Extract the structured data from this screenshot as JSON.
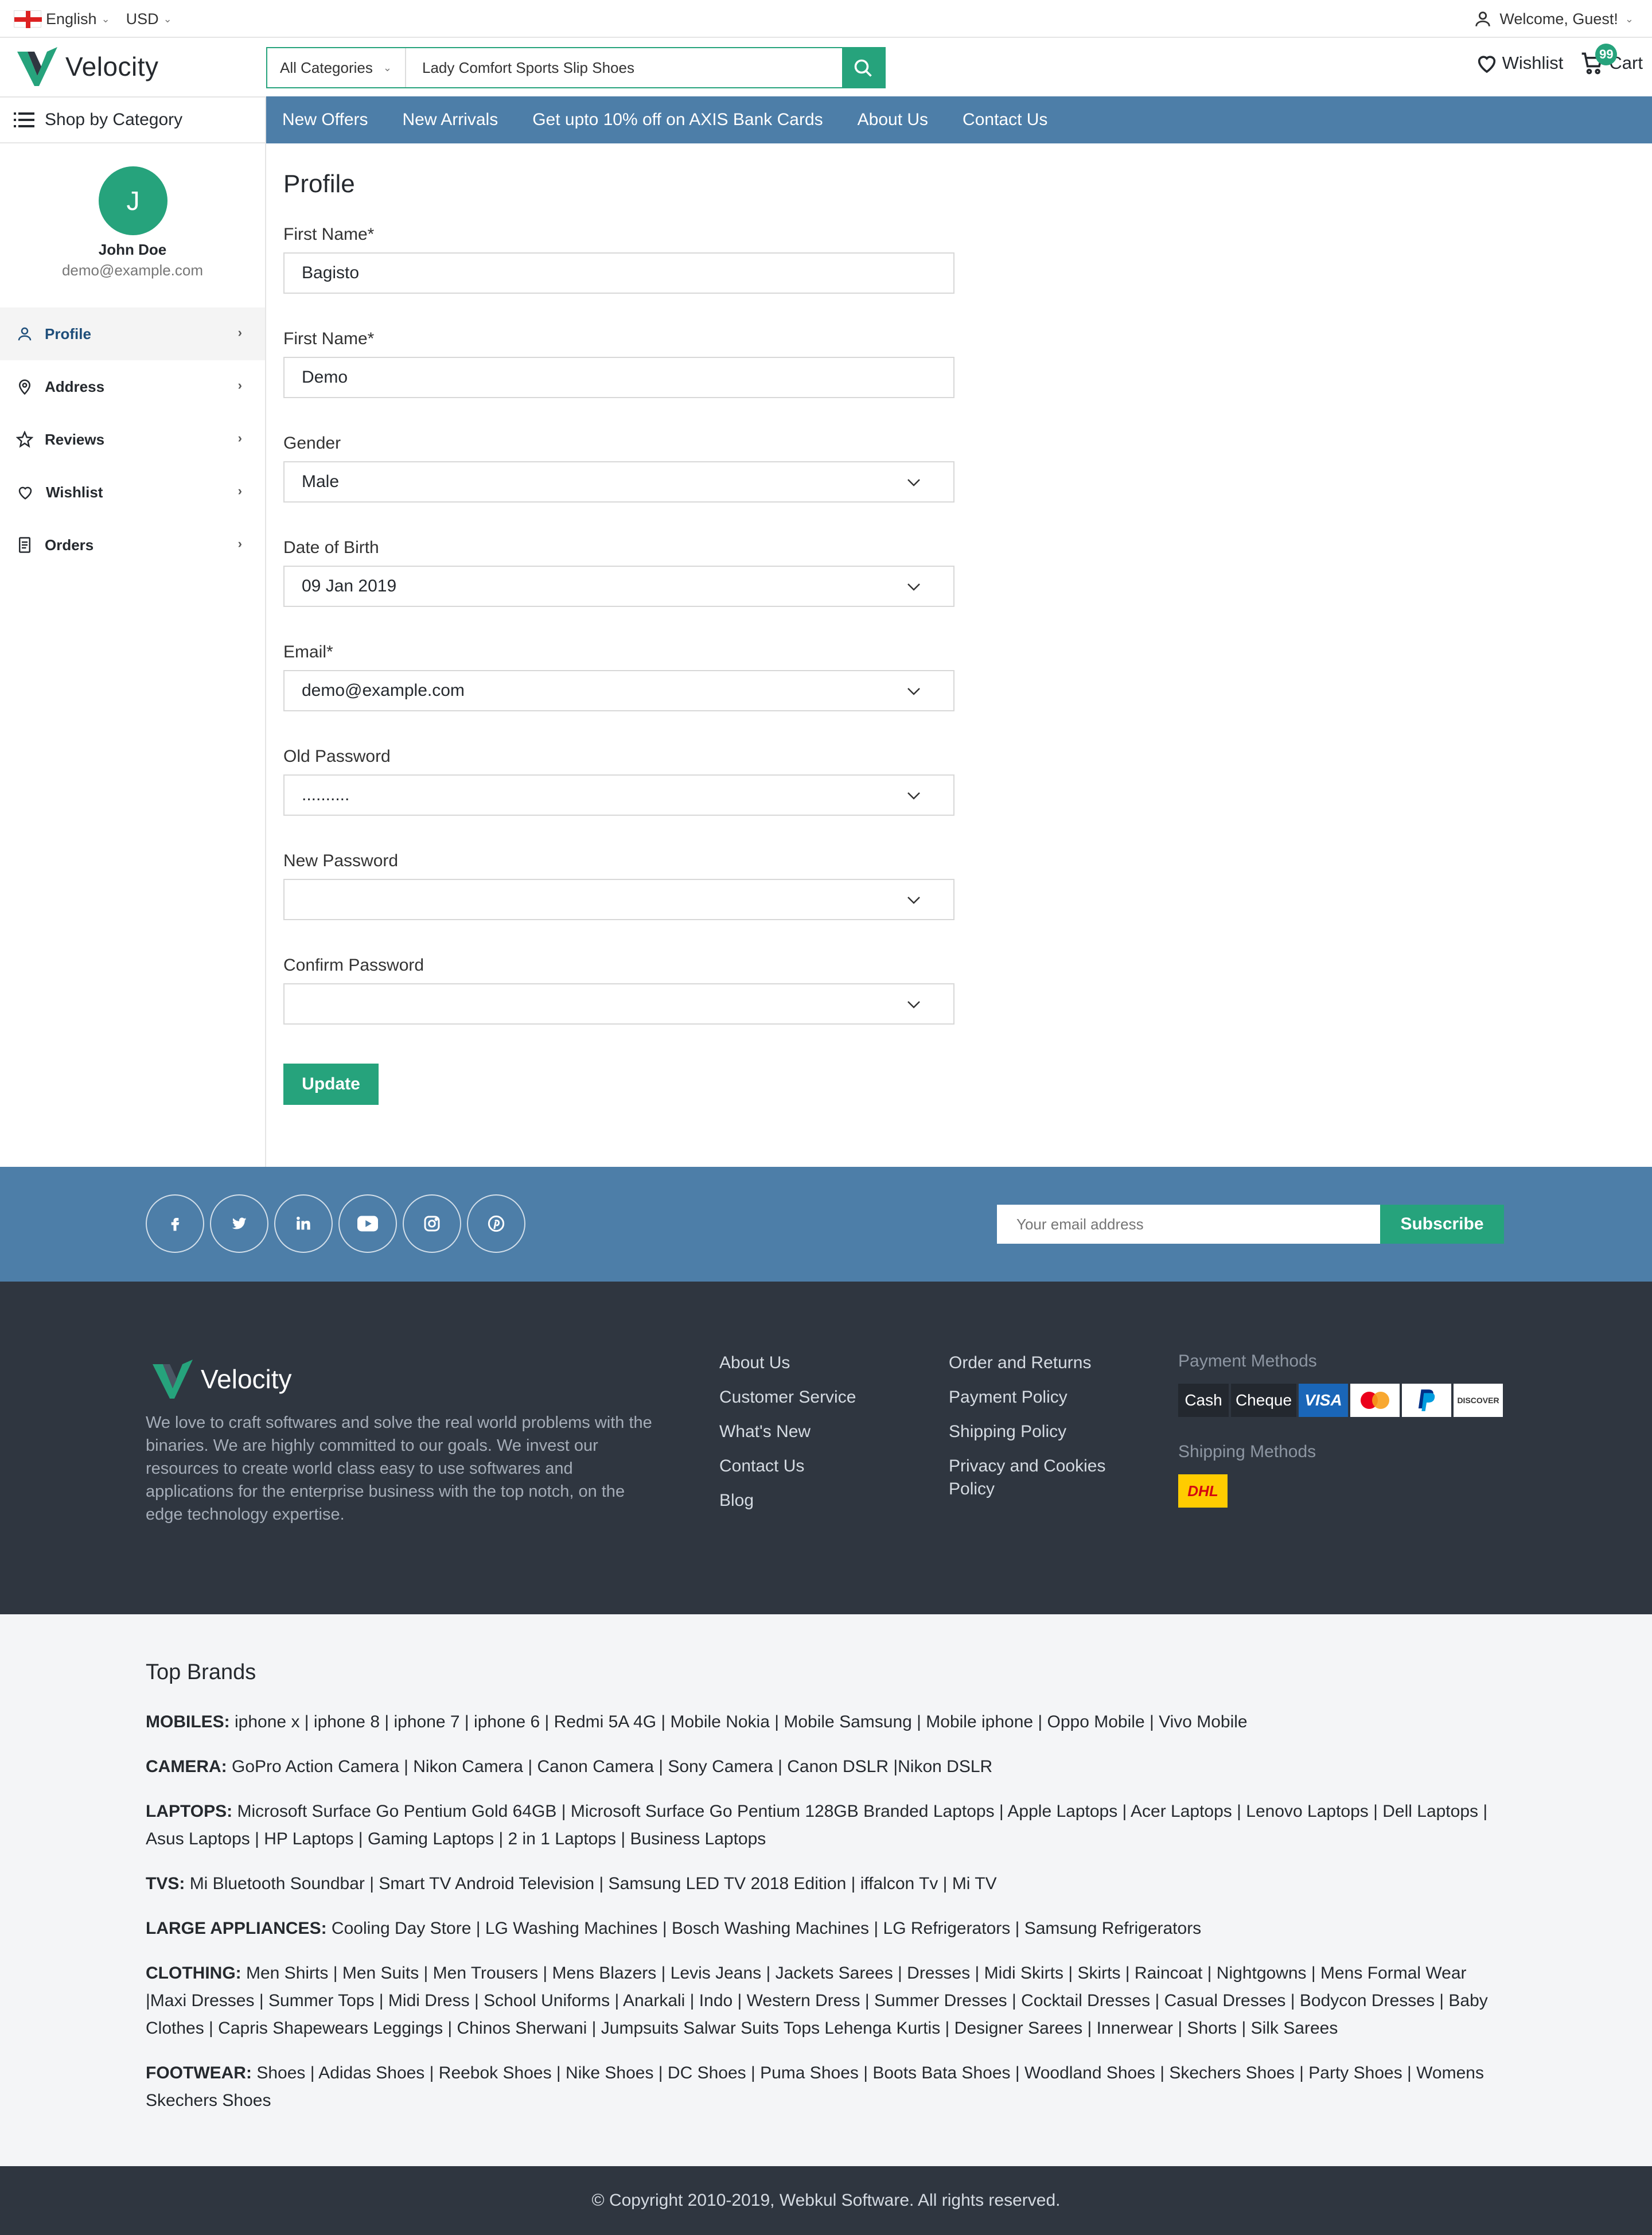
{
  "topbar": {
    "language": "English",
    "currency": "USD",
    "welcome": "Welcome, Guest!"
  },
  "header": {
    "logo": "Velocity",
    "search_category": "All Categories",
    "search_value": "Lady Comfort Sports Slip Shoes",
    "wishlist_label": "Wishlist",
    "cart_label": "Cart",
    "cart_count": "99"
  },
  "nav": {
    "shop_by_category": "Shop by Category",
    "items": [
      "New Offers",
      "New Arrivals",
      "Get upto 10% off on AXIS Bank Cards",
      "About Us",
      "Contact Us"
    ]
  },
  "sidebar": {
    "avatar_initial": "J",
    "name": "John Doe",
    "email": "demo@example.com",
    "items": [
      {
        "label": "Profile",
        "icon": "user-icon"
      },
      {
        "label": "Address",
        "icon": "location-icon"
      },
      {
        "label": "Reviews",
        "icon": "star-icon"
      },
      {
        "label": "Wishlist",
        "icon": "heart-icon"
      },
      {
        "label": "Orders",
        "icon": "document-icon"
      }
    ]
  },
  "form": {
    "title": "Profile",
    "first_name_label": "First Name*",
    "first_name_value": "Bagisto",
    "last_name_label": "First Name*",
    "last_name_value": "Demo",
    "gender_label": "Gender",
    "gender_value": "Male",
    "dob_label": "Date of Birth",
    "dob_value": "09 Jan 2019",
    "email_label": "Email*",
    "email_value": "demo@example.com",
    "old_password_label": "Old Password",
    "old_password_value": "..........",
    "new_password_label": "New Password",
    "new_password_value": "",
    "confirm_password_label": "Confirm Password",
    "confirm_password_value": "",
    "update_label": "Update"
  },
  "newsletter": {
    "placeholder": "Your email address",
    "subscribe_label": "Subscribe"
  },
  "footer": {
    "logo": "Velocity",
    "about": "We love to craft softwares and solve the real world problems with the binaries. We are highly committed to our goals. We invest our resources to create world class easy to use softwares and applications for the enterprise business with the top notch, on the edge technology expertise.",
    "col1": [
      "About Us",
      "Customer Service",
      "What's New",
      "Contact Us",
      "Blog"
    ],
    "col2": [
      "Order and Returns",
      "Payment Policy",
      "Shipping Policy",
      "Privacy and Cookies Policy"
    ],
    "payment_title": "Payment Methods",
    "payment": {
      "cash": "Cash",
      "cheque": "Cheque",
      "visa": "VISA",
      "discover": "DISCOVER"
    },
    "shipping_title": "Shipping Methods",
    "shipping": "DHL"
  },
  "brands": {
    "title": "Top Brands",
    "groups": [
      {
        "label": "MOBILES:",
        "items": "iphone x | iphone 8 | iphone 7 | iphone 6 | Redmi 5A 4G | Mobile Nokia | Mobile Samsung | Mobile iphone | Oppo Mobile | Vivo Mobile"
      },
      {
        "label": "CAMERA:",
        "items": "GoPro Action Camera | Nikon Camera | Canon Camera | Sony Camera | Canon DSLR |Nikon DSLR"
      },
      {
        "label": "LAPTOPS:",
        "items": "Microsoft Surface Go Pentium Gold 64GB | Microsoft Surface Go Pentium 128GB Branded Laptops | Apple Laptops | Acer Laptops | Lenovo Laptops | Dell Laptops | Asus Laptops | HP Laptops | Gaming Laptops | 2 in 1 Laptops | Business Laptops"
      },
      {
        "label": "TVS:",
        "items": "Mi Bluetooth Soundbar | Smart TV Android Television | Samsung LED TV 2018 Edition | iffalcon Tv | Mi TV"
      },
      {
        "label": "LARGE APPLIANCES:",
        "items": "Cooling Day Store | LG Washing Machines | Bosch Washing Machines | LG Refrigerators | Samsung Refrigerators"
      },
      {
        "label": "CLOTHING:",
        "items": "Men Shirts | Men Suits | Men Trousers | Mens Blazers | Levis Jeans | Jackets Sarees | Dresses | Midi Skirts | Skirts | Raincoat | Nightgowns | Mens Formal Wear |Maxi Dresses | Summer Tops | Midi Dress | School Uniforms | Anarkali | Indo | Western Dress | Summer Dresses | Cocktail Dresses | Casual Dresses | Bodycon Dresses | Baby Clothes | Capris Shapewears Leggings | Chinos Sherwani | Jumpsuits Salwar Suits Tops Lehenga Kurtis | Designer Sarees | Innerwear | Shorts | Silk Sarees"
      },
      {
        "label": "FOOTWEAR:",
        "items": "Shoes | Adidas Shoes | Reebok Shoes | Nike Shoes | DC Shoes | Puma Shoes | Boots Bata Shoes | Woodland Shoes | Skechers Shoes | Party Shoes | Womens Skechers Shoes"
      }
    ]
  },
  "copyright": "© Copyright 2010-2019, Webkul Software. All rights reserved.",
  "colors": {
    "accent": "#26a37c",
    "nav_blue": "#4d7ea8",
    "footer_dark": "#2f3640"
  }
}
